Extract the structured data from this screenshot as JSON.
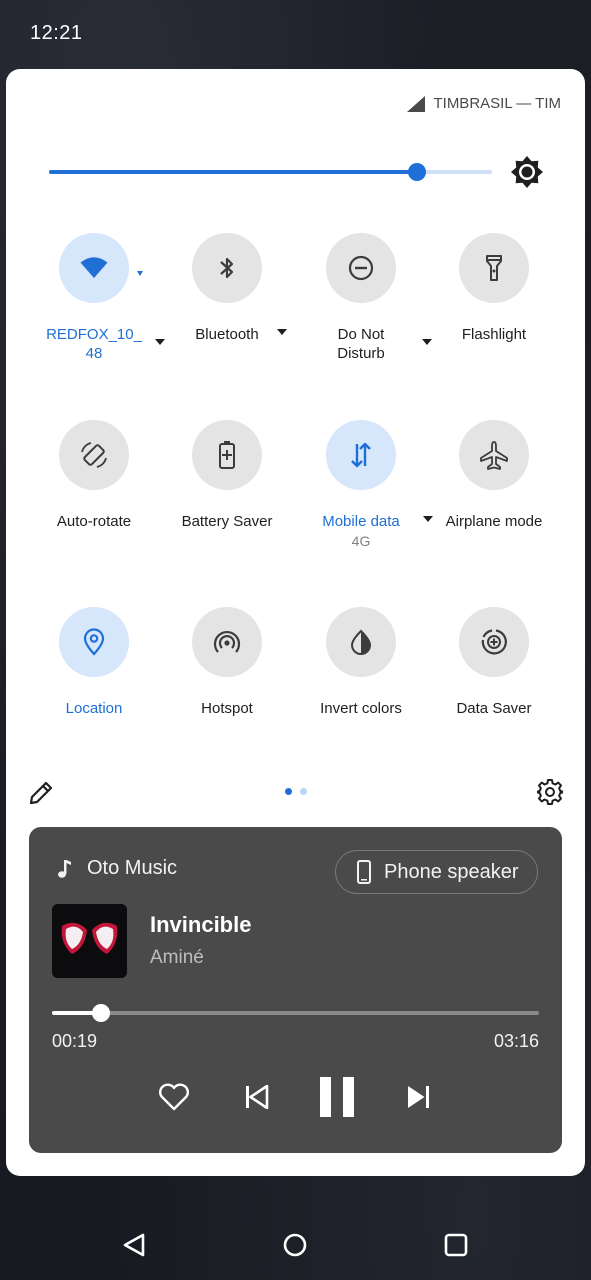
{
  "status_bar": {
    "time": "12:21"
  },
  "panel": {
    "carrier": "TIMBRASIL — TIM",
    "brightness": {
      "level": 0.83
    },
    "tiles": [
      {
        "label": "REDFOX_10_48",
        "label_lines": [
          "REDFOX_10_",
          "48"
        ],
        "icon": "wifi-icon",
        "active": true,
        "has_dropdown": true
      },
      {
        "label": "Bluetooth",
        "label_lines": [
          "Bluetooth"
        ],
        "icon": "bluetooth-icon",
        "active": false,
        "has_dropdown": true
      },
      {
        "label": "Do Not Disturb",
        "label_lines": [
          "Do Not",
          "Disturb"
        ],
        "icon": "do-not-disturb-icon",
        "active": false,
        "has_dropdown": true
      },
      {
        "label": "Flashlight",
        "label_lines": [
          "Flashlight"
        ],
        "icon": "flashlight-icon",
        "active": false,
        "has_dropdown": false
      },
      {
        "label": "Auto-rotate",
        "label_lines": [
          "Auto-rotate"
        ],
        "icon": "auto-rotate-icon",
        "active": false,
        "has_dropdown": false
      },
      {
        "label": "Battery Saver",
        "label_lines": [
          "Battery Saver"
        ],
        "icon": "battery-saver-icon",
        "active": false,
        "has_dropdown": false
      },
      {
        "label": "Mobile data",
        "label_lines": [
          "Mobile data"
        ],
        "sub": "4G",
        "icon": "mobile-data-icon",
        "active": true,
        "has_dropdown": true
      },
      {
        "label": "Airplane mode",
        "label_lines": [
          "Airplane mode"
        ],
        "icon": "airplane-icon",
        "active": false,
        "has_dropdown": false
      },
      {
        "label": "Location",
        "label_lines": [
          "Location"
        ],
        "icon": "location-icon",
        "active": true,
        "has_dropdown": false
      },
      {
        "label": "Hotspot",
        "label_lines": [
          "Hotspot"
        ],
        "icon": "hotspot-icon",
        "active": false,
        "has_dropdown": false
      },
      {
        "label": "Invert colors",
        "label_lines": [
          "Invert colors"
        ],
        "icon": "invert-colors-icon",
        "active": false,
        "has_dropdown": false
      },
      {
        "label": "Data Saver",
        "label_lines": [
          "Data Saver"
        ],
        "icon": "data-saver-icon",
        "active": false,
        "has_dropdown": false
      }
    ],
    "page_indicator": {
      "current": 1,
      "total": 2
    }
  },
  "media": {
    "app_name": "Oto Music",
    "output_device": "Phone speaker",
    "track_title": "Invincible",
    "artist": "Aminé",
    "elapsed": "00:19",
    "duration": "03:16",
    "progress": 0.1,
    "state": "playing"
  },
  "colors": {
    "accent": "#1f6fd6",
    "tile_active_bg": "#d6e6fb",
    "tile_inactive_bg": "#e4e4e4",
    "media_bg": "#4a4a4a"
  }
}
